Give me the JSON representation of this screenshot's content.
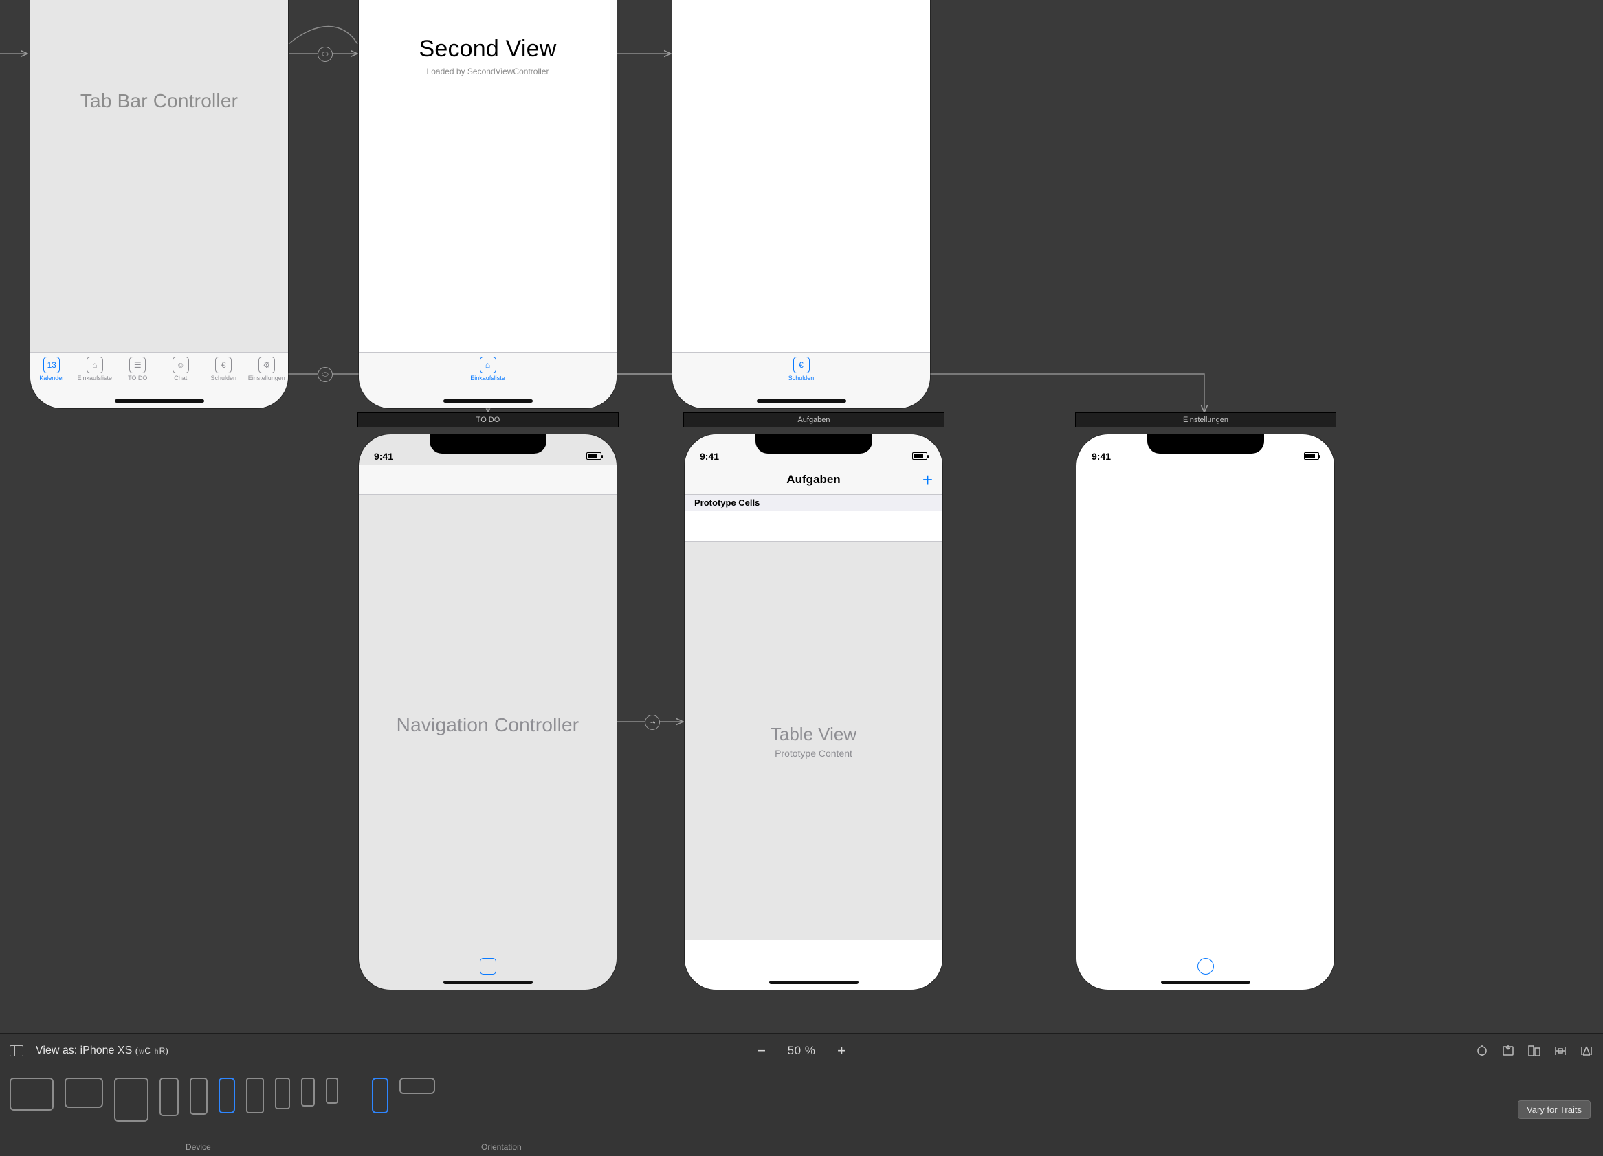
{
  "statusTime": "9:41",
  "tabCtrl": {
    "title": "Tab Bar Controller"
  },
  "secondView": {
    "title": "Second View",
    "subtitle": "Loaded by SecondViewController"
  },
  "tabs": [
    {
      "label": "Kalender"
    },
    {
      "label": "Einkaufsliste"
    },
    {
      "label": "TO DO"
    },
    {
      "label": "Chat"
    },
    {
      "label": "Schulden"
    },
    {
      "label": "Einstellungen"
    }
  ],
  "singleTab2": "Einkaufsliste",
  "singleTab3": "Schulden",
  "sceneTodo": "TO DO",
  "sceneAufgaben": "Aufgaben",
  "sceneEinstellungen": "Einstellungen",
  "navCtrl": {
    "title": "Navigation Controller"
  },
  "aufgaben": {
    "navTitle": "Aufgaben",
    "addGlyph": "+",
    "sectionHeader": "Prototype Cells",
    "tvTitle": "Table View",
    "tvSubtitle": "Prototype Content"
  },
  "bottom": {
    "viewAsPrefix": "View as: ",
    "deviceName": "iPhone XS",
    "sizeW": "w",
    "sizeC": "C",
    "sizeH": "h",
    "sizeR": "R",
    "zoom": "50 %",
    "minus": "−",
    "plus": "+",
    "deviceLabel": "Device",
    "orientLabel": "Orientation",
    "vary": "Vary for Traits"
  }
}
